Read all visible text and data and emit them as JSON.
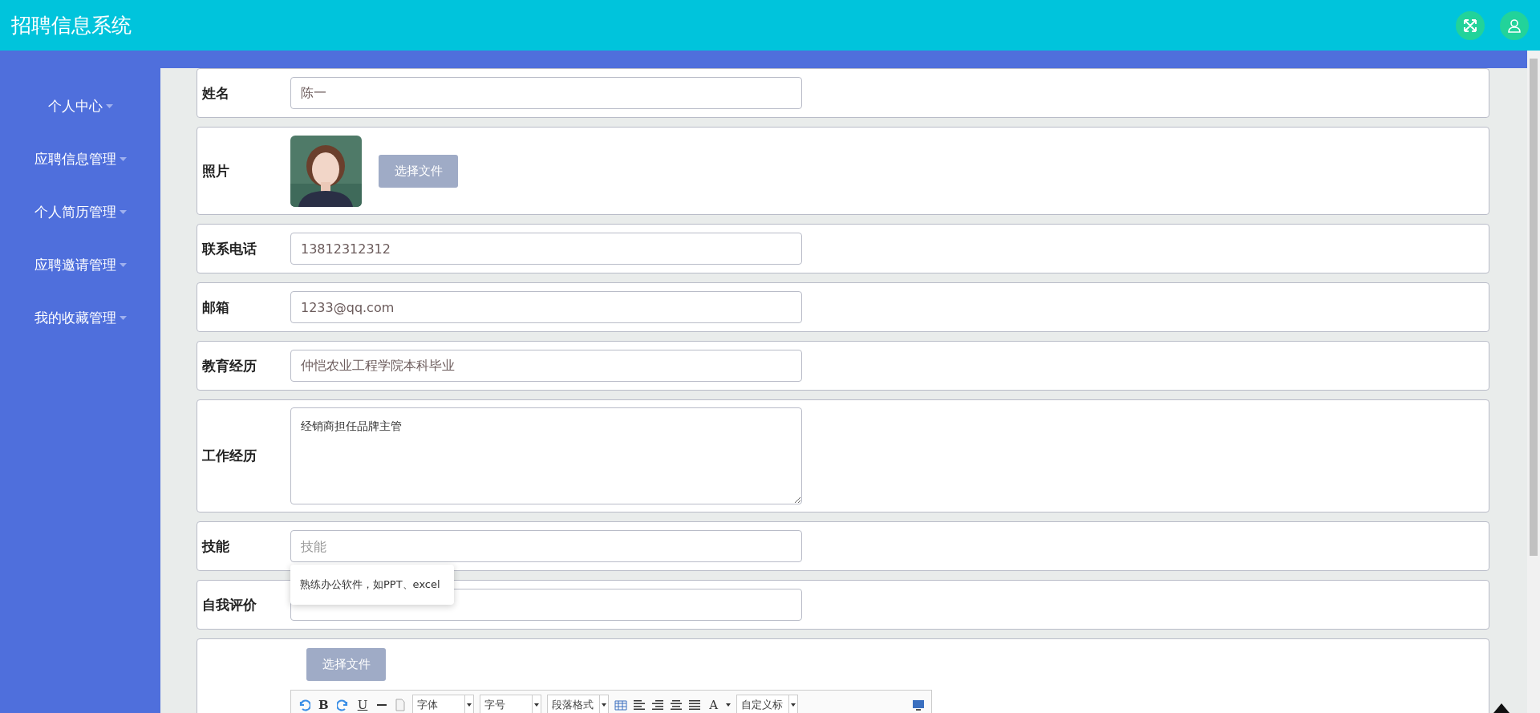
{
  "header": {
    "title": "招聘信息系统"
  },
  "sidebar": {
    "items": [
      {
        "label": "个人中心"
      },
      {
        "label": "应聘信息管理"
      },
      {
        "label": "个人简历管理"
      },
      {
        "label": "应聘邀请管理"
      },
      {
        "label": "我的收藏管理"
      }
    ]
  },
  "form": {
    "rows": [
      {
        "kind": "input",
        "label": "姓名",
        "value": "陈一"
      },
      {
        "label": "照片",
        "button": "选择文件"
      },
      {
        "kind": "input",
        "label": "联系电话",
        "value": "13812312312"
      },
      {
        "kind": "input",
        "label": "邮箱",
        "value": "1233@qq.com"
      },
      {
        "kind": "input",
        "label": "教育经历",
        "value": "仲恺农业工程学院本科毕业"
      },
      {
        "kind": "textarea",
        "label": "工作经历",
        "value": "经销商担任品牌主管"
      },
      {
        "kind": "input",
        "label": "技能",
        "placeholder": "技能",
        "suggestion": "熟练办公软件，如PPT、excel"
      },
      {
        "kind": "input",
        "label": "自我评价"
      },
      {
        "kind": "editor",
        "button": "选择文件"
      }
    ]
  },
  "editor": {
    "toolbar": [
      {
        "kind": "undo"
      },
      {
        "kind": "bold",
        "text": "B"
      },
      {
        "kind": "redo"
      },
      {
        "kind": "underline",
        "text": "U"
      },
      {
        "kind": "hr"
      },
      {
        "kind": "doc"
      },
      {
        "kind": "select",
        "text": "字体"
      },
      {
        "kind": "select",
        "text": "字号"
      },
      {
        "kind": "select",
        "text": "段落格式"
      },
      {
        "kind": "table"
      },
      {
        "kind": "align-left"
      },
      {
        "kind": "align-right"
      },
      {
        "kind": "align-center"
      },
      {
        "kind": "align-justify"
      },
      {
        "kind": "font-color",
        "text": "A"
      },
      {
        "kind": "select",
        "text": "自定义标"
      },
      {
        "kind": "preview"
      }
    ]
  }
}
